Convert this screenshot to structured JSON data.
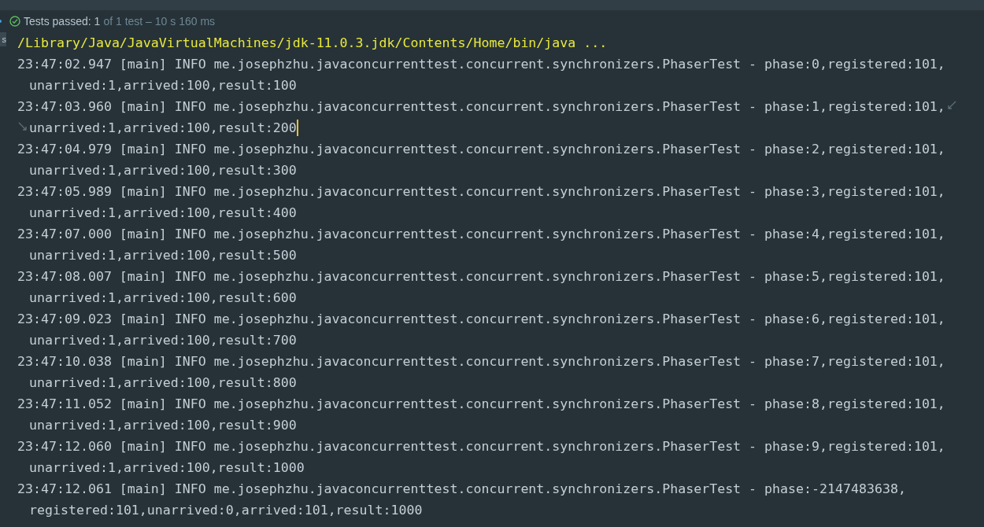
{
  "status_bar": {
    "passed": true,
    "label": "Tests passed:",
    "count": "1",
    "detail": "of 1 test – 10 s 160 ms"
  },
  "side_tab": "s",
  "console": {
    "command": "/Library/Java/JavaVirtualMachines/jdk-11.0.3.jdk/Contents/Home/bin/java ...",
    "entries": [
      {
        "line": "23:47:02.947 [main] INFO me.josephzhu.javaconcurrenttest.concurrent.synchronizers.PhaserTest - phase:0,registered:101,",
        "continuation": "unarrived:1,arrived:100,result:100",
        "wrap_marks": false,
        "cursor": false
      },
      {
        "line": "23:47:03.960 [main] INFO me.josephzhu.javaconcurrenttest.concurrent.synchronizers.PhaserTest - phase:1,registered:101,",
        "continuation": "unarrived:1,arrived:100,result:200",
        "wrap_marks": true,
        "cursor": true
      },
      {
        "line": "23:47:04.979 [main] INFO me.josephzhu.javaconcurrenttest.concurrent.synchronizers.PhaserTest - phase:2,registered:101,",
        "continuation": "unarrived:1,arrived:100,result:300",
        "wrap_marks": false,
        "cursor": false
      },
      {
        "line": "23:47:05.989 [main] INFO me.josephzhu.javaconcurrenttest.concurrent.synchronizers.PhaserTest - phase:3,registered:101,",
        "continuation": "unarrived:1,arrived:100,result:400",
        "wrap_marks": false,
        "cursor": false
      },
      {
        "line": "23:47:07.000 [main] INFO me.josephzhu.javaconcurrenttest.concurrent.synchronizers.PhaserTest - phase:4,registered:101,",
        "continuation": "unarrived:1,arrived:100,result:500",
        "wrap_marks": false,
        "cursor": false
      },
      {
        "line": "23:47:08.007 [main] INFO me.josephzhu.javaconcurrenttest.concurrent.synchronizers.PhaserTest - phase:5,registered:101,",
        "continuation": "unarrived:1,arrived:100,result:600",
        "wrap_marks": false,
        "cursor": false
      },
      {
        "line": "23:47:09.023 [main] INFO me.josephzhu.javaconcurrenttest.concurrent.synchronizers.PhaserTest - phase:6,registered:101,",
        "continuation": "unarrived:1,arrived:100,result:700",
        "wrap_marks": false,
        "cursor": false
      },
      {
        "line": "23:47:10.038 [main] INFO me.josephzhu.javaconcurrenttest.concurrent.synchronizers.PhaserTest - phase:7,registered:101,",
        "continuation": "unarrived:1,arrived:100,result:800",
        "wrap_marks": false,
        "cursor": false
      },
      {
        "line": "23:47:11.052 [main] INFO me.josephzhu.javaconcurrenttest.concurrent.synchronizers.PhaserTest - phase:8,registered:101,",
        "continuation": "unarrived:1,arrived:100,result:900",
        "wrap_marks": false,
        "cursor": false
      },
      {
        "line": "23:47:12.060 [main] INFO me.josephzhu.javaconcurrenttest.concurrent.synchronizers.PhaserTest - phase:9,registered:101,",
        "continuation": "unarrived:1,arrived:100,result:1000",
        "wrap_marks": false,
        "cursor": false
      },
      {
        "line": "23:47:12.061 [main] INFO me.josephzhu.javaconcurrenttest.concurrent.synchronizers.PhaserTest - phase:-2147483638,",
        "continuation": "registered:101,unarrived:0,arrived:101,result:1000",
        "wrap_marks": false,
        "cursor": false
      }
    ]
  }
}
